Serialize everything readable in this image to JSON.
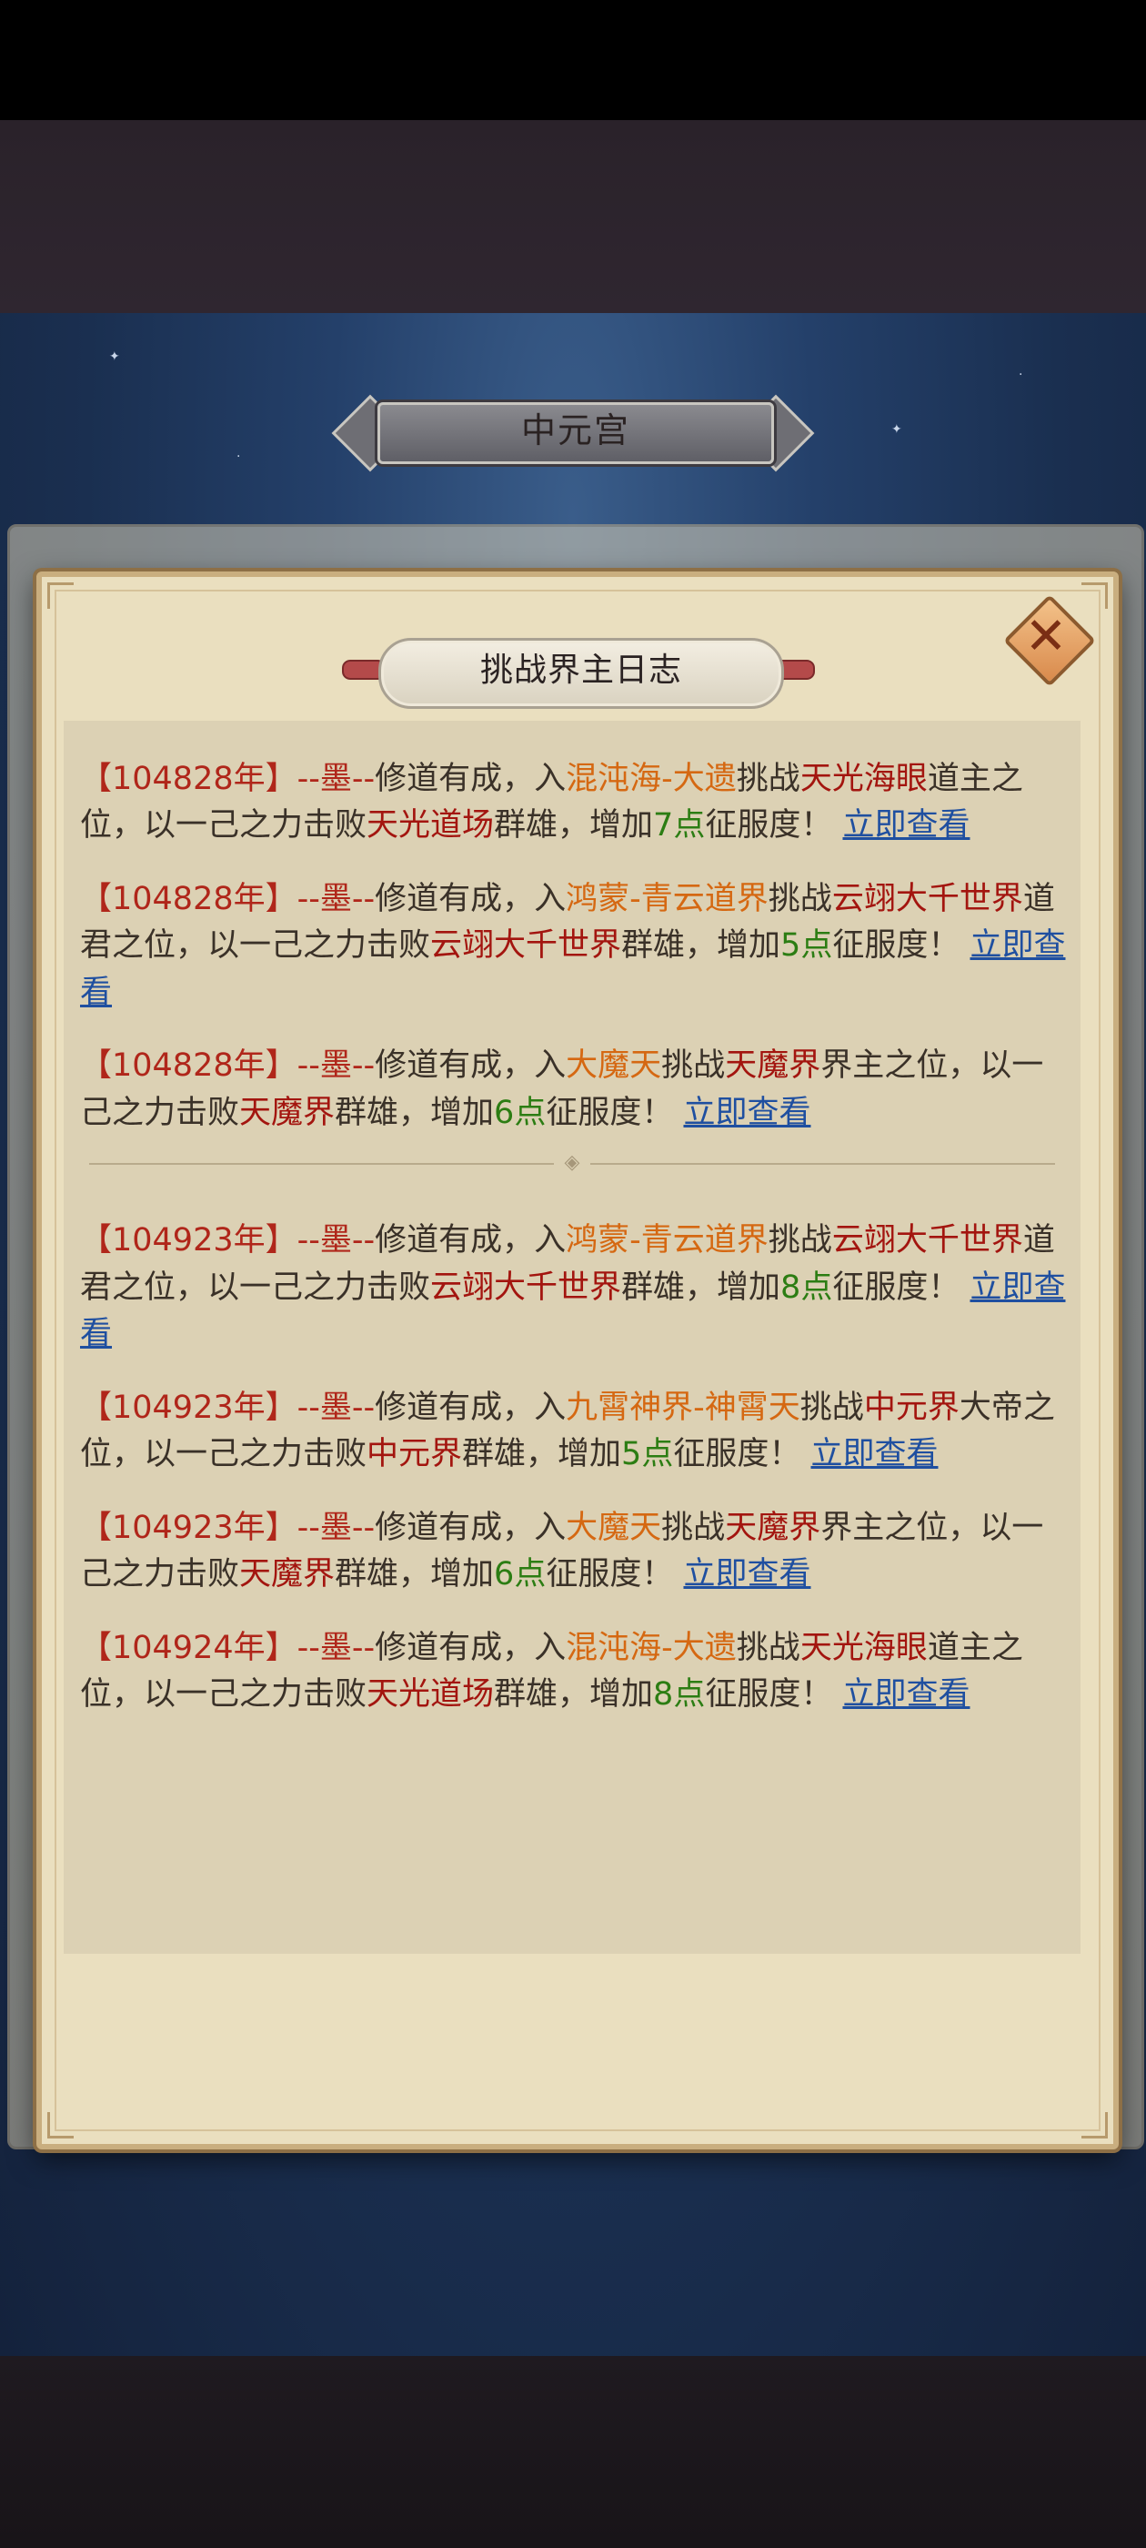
{
  "header": {
    "title": "中元宫"
  },
  "dialog": {
    "title": "挑战界主日志"
  },
  "entries": [
    {
      "id": "e0",
      "partial": true,
      "segments": [
        {
          "t": "界大帝之位，以一己之力击败",
          "c": "plain"
        },
        {
          "t": "中元界",
          "c": "target"
        },
        {
          "t": "群雄，增加",
          "c": "plain"
        },
        {
          "t": "5点",
          "c": "pts"
        },
        {
          "t": "征服度！",
          "c": "plain"
        },
        {
          "t": "立即查看",
          "c": "link"
        }
      ]
    },
    {
      "id": "e1",
      "segments": [
        {
          "t": "【104828年】",
          "c": "yr"
        },
        {
          "t": "--墨--",
          "c": "name"
        },
        {
          "t": "修道有成，入",
          "c": "plain"
        },
        {
          "t": "混沌海-大遗",
          "c": "place"
        },
        {
          "t": "挑战",
          "c": "plain"
        },
        {
          "t": "天光海眼",
          "c": "target"
        },
        {
          "t": "道主之位，以一己之力击败",
          "c": "plain"
        },
        {
          "t": "天光道场",
          "c": "target"
        },
        {
          "t": "群雄，增加",
          "c": "plain"
        },
        {
          "t": "7点",
          "c": "pts"
        },
        {
          "t": "征服度！ ",
          "c": "plain"
        },
        {
          "t": "立即查看",
          "c": "link"
        }
      ]
    },
    {
      "id": "e2",
      "segments": [
        {
          "t": "【104828年】",
          "c": "yr"
        },
        {
          "t": "--墨--",
          "c": "name"
        },
        {
          "t": "修道有成，入",
          "c": "plain"
        },
        {
          "t": "鸿蒙-青云道界",
          "c": "place"
        },
        {
          "t": "挑战",
          "c": "plain"
        },
        {
          "t": "云翊大千世界",
          "c": "target"
        },
        {
          "t": "道君之位，以一己之力击败",
          "c": "plain"
        },
        {
          "t": "云翊大千世界",
          "c": "target"
        },
        {
          "t": "群雄，增加",
          "c": "plain"
        },
        {
          "t": "5点",
          "c": "pts"
        },
        {
          "t": "征服度！ ",
          "c": "plain"
        },
        {
          "t": "立即查看",
          "c": "link"
        }
      ]
    },
    {
      "id": "e3",
      "segments": [
        {
          "t": "【104828年】",
          "c": "yr"
        },
        {
          "t": "--墨--",
          "c": "name"
        },
        {
          "t": "修道有成，入",
          "c": "plain"
        },
        {
          "t": "大魔天",
          "c": "place"
        },
        {
          "t": "挑战",
          "c": "plain"
        },
        {
          "t": "天魔界",
          "c": "target"
        },
        {
          "t": "界主之位，以一己之力击败",
          "c": "plain"
        },
        {
          "t": "天魔界",
          "c": "target"
        },
        {
          "t": "群雄，增加",
          "c": "plain"
        },
        {
          "t": "6点",
          "c": "pts"
        },
        {
          "t": "征服度！ ",
          "c": "plain"
        },
        {
          "t": "立即查看",
          "c": "link"
        }
      ]
    },
    {
      "id": "divider",
      "divider": true
    },
    {
      "id": "e4",
      "segments": [
        {
          "t": "【104923年】",
          "c": "yr"
        },
        {
          "t": "--墨--",
          "c": "name"
        },
        {
          "t": "修道有成，入",
          "c": "plain"
        },
        {
          "t": "鸿蒙-青云道界",
          "c": "place"
        },
        {
          "t": "挑战",
          "c": "plain"
        },
        {
          "t": "云翊大千世界",
          "c": "target"
        },
        {
          "t": "道君之位，以一己之力击败",
          "c": "plain"
        },
        {
          "t": "云翊大千世界",
          "c": "target"
        },
        {
          "t": "群雄，增加",
          "c": "plain"
        },
        {
          "t": "8点",
          "c": "pts"
        },
        {
          "t": "征服度！ ",
          "c": "plain"
        },
        {
          "t": "立即查看",
          "c": "link"
        }
      ]
    },
    {
      "id": "e5",
      "segments": [
        {
          "t": "【104923年】",
          "c": "yr"
        },
        {
          "t": "--墨--",
          "c": "name"
        },
        {
          "t": "修道有成，入",
          "c": "plain"
        },
        {
          "t": "九霄神界-神霄天",
          "c": "place"
        },
        {
          "t": "挑战",
          "c": "plain"
        },
        {
          "t": "中元界",
          "c": "target"
        },
        {
          "t": "大帝之位，以一己之力击败",
          "c": "plain"
        },
        {
          "t": "中元界",
          "c": "target"
        },
        {
          "t": "群雄，增加",
          "c": "plain"
        },
        {
          "t": "5点",
          "c": "pts"
        },
        {
          "t": "征服度！ ",
          "c": "plain"
        },
        {
          "t": "立即查看",
          "c": "link"
        }
      ]
    },
    {
      "id": "e6",
      "segments": [
        {
          "t": "【104923年】",
          "c": "yr"
        },
        {
          "t": "--墨--",
          "c": "name"
        },
        {
          "t": "修道有成，入",
          "c": "plain"
        },
        {
          "t": "大魔天",
          "c": "place"
        },
        {
          "t": "挑战",
          "c": "plain"
        },
        {
          "t": "天魔界",
          "c": "target"
        },
        {
          "t": "界主之位，以一己之力击败",
          "c": "plain"
        },
        {
          "t": "天魔界",
          "c": "target"
        },
        {
          "t": "群雄，增加",
          "c": "plain"
        },
        {
          "t": "6点",
          "c": "pts"
        },
        {
          "t": "征服度！ ",
          "c": "plain"
        },
        {
          "t": "立即查看",
          "c": "link"
        }
      ]
    },
    {
      "id": "e7",
      "segments": [
        {
          "t": "【104924年】",
          "c": "yr"
        },
        {
          "t": "--墨--",
          "c": "name"
        },
        {
          "t": "修道有成，入",
          "c": "plain"
        },
        {
          "t": "混沌海-大遗",
          "c": "place"
        },
        {
          "t": "挑战",
          "c": "plain"
        },
        {
          "t": "天光海眼",
          "c": "target"
        },
        {
          "t": "道主之位，以一己之力击败",
          "c": "plain"
        },
        {
          "t": "天光道场",
          "c": "target"
        },
        {
          "t": "群雄，增加",
          "c": "plain"
        },
        {
          "t": "8点",
          "c": "pts"
        },
        {
          "t": "征服度！ ",
          "c": "plain"
        },
        {
          "t": "立即查看",
          "c": "link"
        }
      ]
    }
  ],
  "colors": {
    "year": "#b0261a",
    "place": "#d56812",
    "target": "#a3150f",
    "points": "#2c7d13",
    "link": "#1f4fa0",
    "text": "#3a3128"
  },
  "icons": {
    "close": "close-icon"
  }
}
